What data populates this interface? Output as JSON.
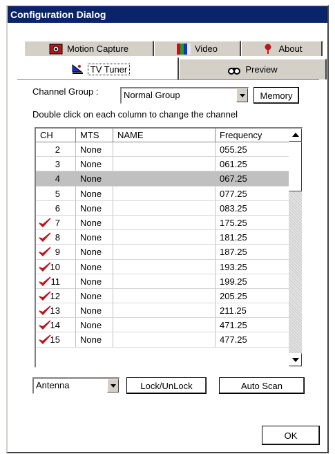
{
  "window": {
    "title": "Configuration Dialog"
  },
  "tabs": [
    {
      "label": "Motion Capture",
      "icon": "webcam-icon"
    },
    {
      "label": "Video",
      "icon": "color-bars-icon"
    },
    {
      "label": "About",
      "icon": "info-pin-icon"
    },
    {
      "label": "TV Tuner",
      "icon": "satellite-dish-icon",
      "active": true
    },
    {
      "label": "Preview",
      "icon": "binoculars-icon"
    }
  ],
  "channel_group": {
    "label": "Channel Group :",
    "value": "Normal Group"
  },
  "memory_button": "Memory",
  "instruction": "Double click on each column to change the channel",
  "table": {
    "headers": {
      "ch": "CH",
      "mts": "MTS",
      "name": "NAME",
      "freq": "Frequency"
    },
    "selected_row": 2,
    "rows": [
      {
        "ch": "2",
        "mts": "None",
        "name": "",
        "freq": "055.25",
        "checked": false
      },
      {
        "ch": "3",
        "mts": "None",
        "name": "",
        "freq": "061.25",
        "checked": false
      },
      {
        "ch": "4",
        "mts": "None",
        "name": "",
        "freq": "067.25",
        "checked": false
      },
      {
        "ch": "5",
        "mts": "None",
        "name": "",
        "freq": "077.25",
        "checked": false
      },
      {
        "ch": "6",
        "mts": "None",
        "name": "",
        "freq": "083.25",
        "checked": false
      },
      {
        "ch": "7",
        "mts": "None",
        "name": "",
        "freq": "175.25",
        "checked": true
      },
      {
        "ch": "8",
        "mts": "None",
        "name": "",
        "freq": "181.25",
        "checked": true
      },
      {
        "ch": "9",
        "mts": "None",
        "name": "",
        "freq": "187.25",
        "checked": true
      },
      {
        "ch": "10",
        "mts": "None",
        "name": "",
        "freq": "193.25",
        "checked": true
      },
      {
        "ch": "11",
        "mts": "None",
        "name": "",
        "freq": "199.25",
        "checked": true
      },
      {
        "ch": "12",
        "mts": "None",
        "name": "",
        "freq": "205.25",
        "checked": true
      },
      {
        "ch": "13",
        "mts": "None",
        "name": "",
        "freq": "211.25",
        "checked": true
      },
      {
        "ch": "14",
        "mts": "None",
        "name": "",
        "freq": "471.25",
        "checked": true
      },
      {
        "ch": "15",
        "mts": "None",
        "name": "",
        "freq": "477.25",
        "checked": true
      }
    ]
  },
  "input_source": {
    "value": "Antenna"
  },
  "lock_button": "Lock/UnLock",
  "autoscan_button": "Auto Scan",
  "ok_button": "OK",
  "colors": {
    "titlebar": "#0a246a",
    "check": "#c0141c",
    "selected_row": "#c0c0c0"
  }
}
